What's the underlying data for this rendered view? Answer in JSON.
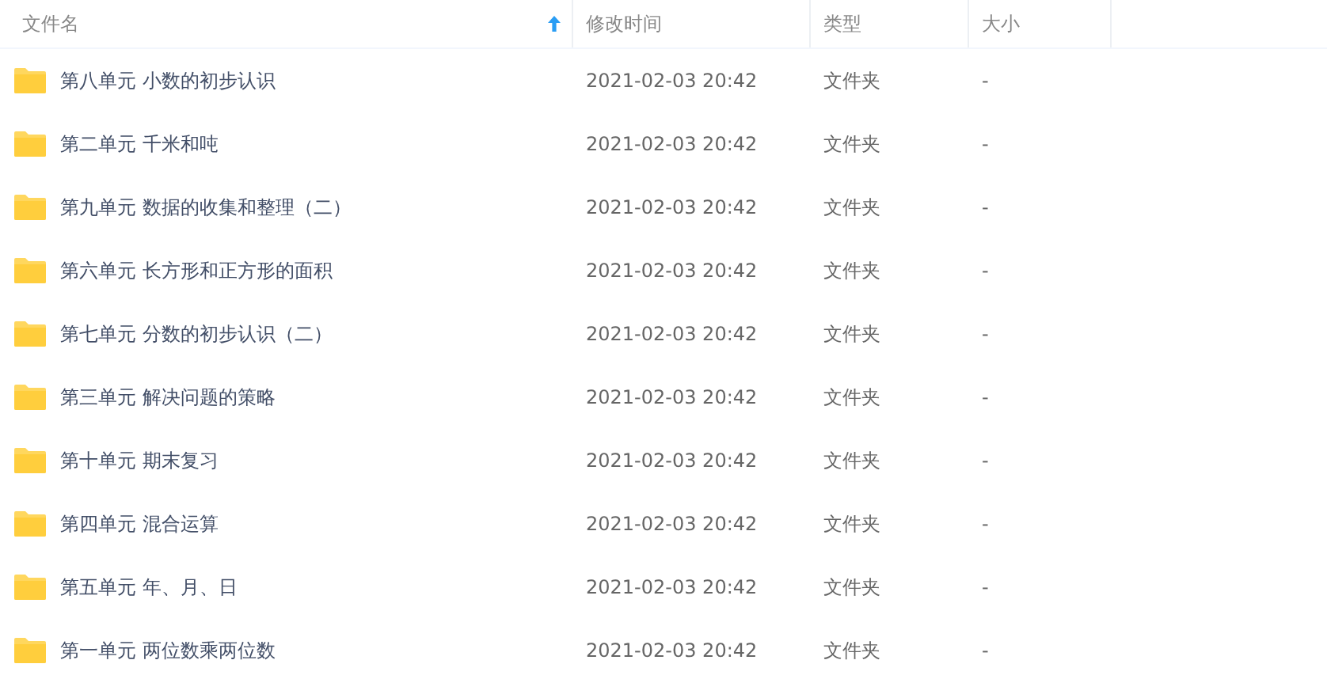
{
  "table": {
    "columns": [
      {
        "label": "文件名",
        "sorted": true
      },
      {
        "label": "修改时间",
        "sorted": false
      },
      {
        "label": "类型",
        "sorted": false
      },
      {
        "label": "大小",
        "sorted": false
      }
    ],
    "rows": [
      {
        "name": "第八单元 小数的初步认识",
        "modified": "2021-02-03 20:42",
        "type": "文件夹",
        "size": "-"
      },
      {
        "name": "第二单元 千米和吨",
        "modified": "2021-02-03 20:42",
        "type": "文件夹",
        "size": "-"
      },
      {
        "name": "第九单元 数据的收集和整理（二）",
        "modified": "2021-02-03 20:42",
        "type": "文件夹",
        "size": "-"
      },
      {
        "name": "第六单元 长方形和正方形的面积",
        "modified": "2021-02-03 20:42",
        "type": "文件夹",
        "size": "-"
      },
      {
        "name": "第七单元 分数的初步认识（二）",
        "modified": "2021-02-03 20:42",
        "type": "文件夹",
        "size": "-"
      },
      {
        "name": "第三单元 解决问题的策略",
        "modified": "2021-02-03 20:42",
        "type": "文件夹",
        "size": "-"
      },
      {
        "name": "第十单元 期末复习",
        "modified": "2021-02-03 20:42",
        "type": "文件夹",
        "size": "-"
      },
      {
        "name": "第四单元 混合运算",
        "modified": "2021-02-03 20:42",
        "type": "文件夹",
        "size": "-"
      },
      {
        "name": "第五单元 年、月、日",
        "modified": "2021-02-03 20:42",
        "type": "文件夹",
        "size": "-"
      },
      {
        "name": "第一单元 两位数乘两位数",
        "modified": "2021-02-03 20:42",
        "type": "文件夹",
        "size": "-"
      }
    ]
  }
}
